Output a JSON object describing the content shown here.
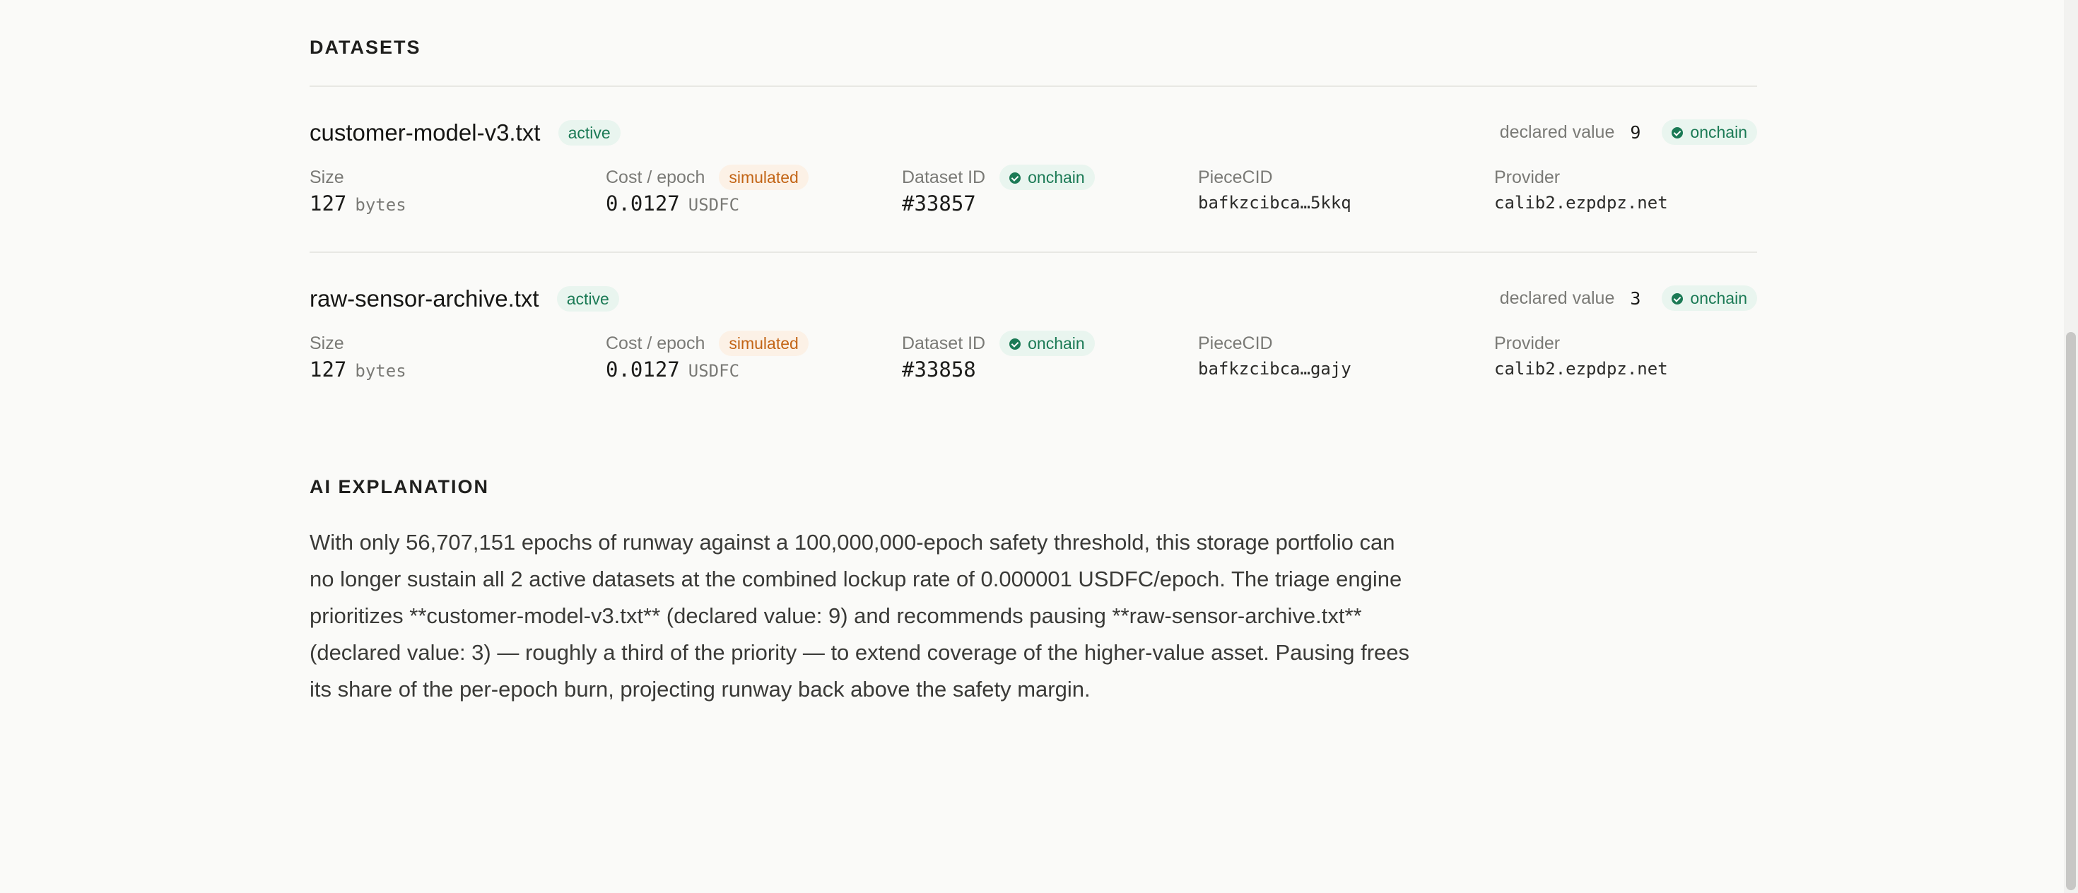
{
  "datasets_section": {
    "title": "DATASETS",
    "items": [
      {
        "name": "customer-model-v3.txt",
        "status": "active",
        "declared_label": "declared value",
        "declared_value": "9",
        "chain_badge": "onchain",
        "size_label": "Size",
        "size_value": "127",
        "size_unit": "bytes",
        "cost_label": "Cost / epoch",
        "cost_badge": "simulated",
        "cost_value": "0.0127",
        "cost_unit": "USDFC",
        "dataset_id_label": "Dataset ID",
        "dataset_id_badge": "onchain",
        "dataset_id": "#33857",
        "piece_label": "PieceCID",
        "piece_cid": "bafkzcibca…5kkq",
        "provider_label": "Provider",
        "provider": "calib2.ezpdpz.net"
      },
      {
        "name": "raw-sensor-archive.txt",
        "status": "active",
        "declared_label": "declared value",
        "declared_value": "3",
        "chain_badge": "onchain",
        "size_label": "Size",
        "size_value": "127",
        "size_unit": "bytes",
        "cost_label": "Cost / epoch",
        "cost_badge": "simulated",
        "cost_value": "0.0127",
        "cost_unit": "USDFC",
        "dataset_id_label": "Dataset ID",
        "dataset_id_badge": "onchain",
        "dataset_id": "#33858",
        "piece_label": "PieceCID",
        "piece_cid": "bafkzcibca…gajy",
        "provider_label": "Provider",
        "provider": "calib2.ezpdpz.net"
      }
    ]
  },
  "ai_section": {
    "title": "AI EXPLANATION",
    "text": "With only 56,707,151 epochs of runway against a 100,000,000-epoch safety threshold, this storage portfolio can no longer sustain all 2 active datasets at the combined lockup rate of 0.000001 USDFC/epoch. The triage engine prioritizes **customer-model-v3.txt** (declared value: 9) and recommends pausing **raw-sensor-archive.txt** (declared value: 3) — roughly a third of the priority — to extend coverage of the higher-value asset. Pausing frees its share of the per-epoch burn, projecting runway back above the safety margin."
  },
  "colors": {
    "active_bg": "#e9f5ef",
    "active_fg": "#1b7a55",
    "simulated_bg": "#fcf1e6",
    "simulated_fg": "#c36516"
  }
}
